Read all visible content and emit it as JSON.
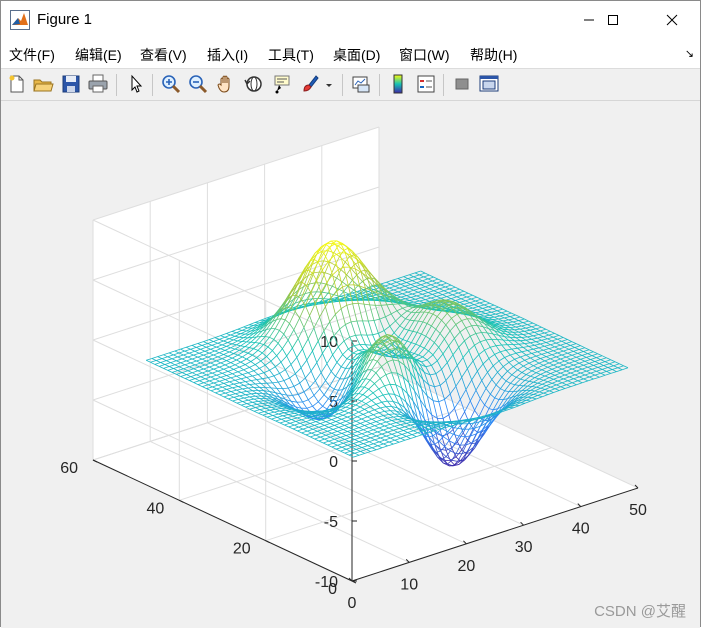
{
  "window": {
    "title": "Figure 1",
    "controls": {
      "minimize": "minimize",
      "maximize": "maximize",
      "close": "close"
    }
  },
  "menu": {
    "items": [
      "文件(F)",
      "编辑(E)",
      "查看(V)",
      "插入(I)",
      "工具(T)",
      "桌面(D)",
      "窗口(W)",
      "帮助(H)"
    ],
    "corner_glyph": "↘"
  },
  "toolbar": {
    "buttons": [
      "new-figure-icon",
      "open-file-icon",
      "save-icon",
      "print-icon",
      "edit-plot-arrow-icon",
      "zoom-in-icon",
      "zoom-out-icon",
      "pan-hand-icon",
      "rotate-3d-icon",
      "data-cursor-icon",
      "brush-icon",
      "link-plot-icon",
      "colorbar-icon",
      "legend-icon",
      "hide-plot-tools-icon",
      "show-plot-tools-icon"
    ]
  },
  "watermark": "CSDN @艾醒",
  "chart_data": {
    "type": "mesh",
    "function": "peaks",
    "grid_size": 49,
    "x_ticks": [
      0,
      10,
      20,
      30,
      40,
      50
    ],
    "y_ticks": [
      0,
      20,
      40,
      60
    ],
    "z_ticks": [
      -10,
      -5,
      0,
      5,
      10
    ],
    "xlim": [
      0,
      50
    ],
    "ylim": [
      0,
      60
    ],
    "zlim": [
      -10,
      10
    ],
    "grid": true,
    "box": "back planes with gridlines",
    "colormap": "parula",
    "colors": {
      "low": "#3e26a8",
      "mid": "#16c3b6",
      "high": "#f9fb0e",
      "axes": "#262626",
      "grid": "#dedede"
    }
  }
}
